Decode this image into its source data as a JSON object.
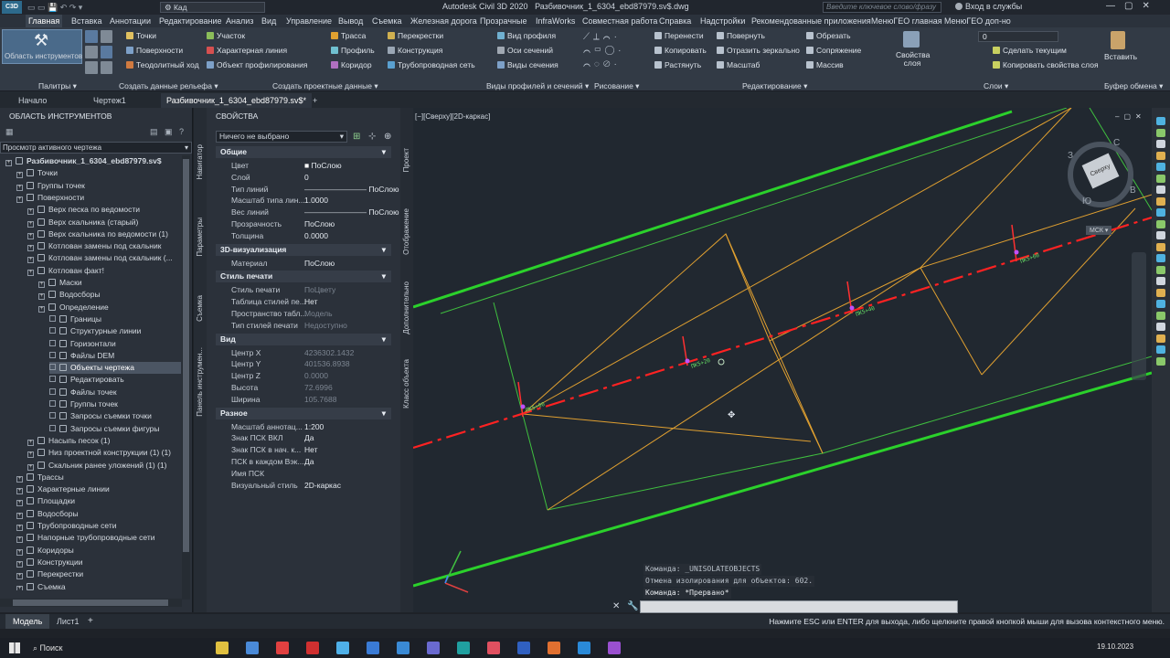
{
  "title": {
    "app": "Autodesk Civil 3D 2020",
    "file": "Разбивочник_1_6304_ebd87979.sv$.dwg",
    "quick_workspace": "Кад",
    "search_placeholder": "Введите ключевое слово/фразу",
    "signin": "Вход в службы"
  },
  "menu_tabs": [
    "Главная",
    "Вставка",
    "Аннотации",
    "Редактирование",
    "Анализ",
    "Вид",
    "Управление",
    "Вывод",
    "Съемка",
    "Железная дорога",
    "Прозрачные",
    "InfraWorks",
    "Совместная работа",
    "Справка",
    "Надстройки",
    "Рекомендованные приложения",
    "МенюГЕО главная",
    "МенюГЕО доп-но"
  ],
  "ribbon": {
    "toolspace_label": "Область инструментов",
    "palettes": "Палитры",
    "terrain_items": [
      "Точки",
      "Поверхности",
      "Теодолитный ход"
    ],
    "terrain_group": "Создать данные рельефа",
    "design_items": [
      "Участок",
      "Характерная линия",
      "Объект профилирования",
      "Трасса",
      "Профиль",
      "Коридор",
      "Перекрестки",
      "Конструкция",
      "Трубопроводная сеть"
    ],
    "design_group": "Создать проектные данные",
    "views_items": [
      "Вид профиля",
      "Оси сечений",
      "Виды сечения"
    ],
    "views_group": "Виды профилей и сечений",
    "draw_group": "Рисование",
    "edit_items": [
      "Перенести",
      "Копировать",
      "Растянуть",
      "Повернуть",
      "Отразить зеркально",
      "Масштаб",
      "Обрезать",
      "Сопряжение",
      "Массив"
    ],
    "edit_group": "Редактирование",
    "layer_props": "Свойства слоя",
    "layer_value": "0",
    "layer_items": [
      "Сделать текущим",
      "Копировать свойства слоя"
    ],
    "layers_group": "Слои",
    "paste": "Вставить",
    "clipboard_group": "Буфер обмена"
  },
  "doc_tabs": [
    "Начало",
    "Чертеж1",
    "Разбивочник_1_6304_ebd87979.sv$*"
  ],
  "toolspace": {
    "title": "ОБЛАСТЬ ИНСТРУМЕНТОВ",
    "view_select": "Просмотр активного чертежа",
    "tree": [
      {
        "label": "Разбивочник_1_6304_ebd87979.sv$",
        "indent": 0,
        "bold": true
      },
      {
        "label": "Точки",
        "indent": 1
      },
      {
        "label": "Группы точек",
        "indent": 1
      },
      {
        "label": "Поверхности",
        "indent": 1
      },
      {
        "label": "Верх песка по ведомости",
        "indent": 2
      },
      {
        "label": "Верх скальника (старый)",
        "indent": 2
      },
      {
        "label": "Верх скальника по ведомости (1)",
        "indent": 2
      },
      {
        "label": "Котлован замены под скальник",
        "indent": 2
      },
      {
        "label": "Котлован замены под скальник (...",
        "indent": 2
      },
      {
        "label": "Котлован факт!",
        "indent": 2
      },
      {
        "label": "Маски",
        "indent": 3
      },
      {
        "label": "Водосборы",
        "indent": 3
      },
      {
        "label": "Определение",
        "indent": 3
      },
      {
        "label": "Границы",
        "indent": 4
      },
      {
        "label": "Структурные линии",
        "indent": 4
      },
      {
        "label": "Горизонтали",
        "indent": 4
      },
      {
        "label": "Файлы DEM",
        "indent": 4
      },
      {
        "label": "Объекты чертежа",
        "indent": 4,
        "selected": true
      },
      {
        "label": "Редактировать",
        "indent": 4
      },
      {
        "label": "Файлы точек",
        "indent": 4
      },
      {
        "label": "Группы точек",
        "indent": 4
      },
      {
        "label": "Запросы съемки точки",
        "indent": 4
      },
      {
        "label": "Запросы съемки фигуры",
        "indent": 4
      },
      {
        "label": "Насыпь песок (1)",
        "indent": 2
      },
      {
        "label": "Низ проектной конструкции (1) (1)",
        "indent": 2
      },
      {
        "label": "Скальник ранее уложений (1) (1)",
        "indent": 2
      },
      {
        "label": "Трассы",
        "indent": 1
      },
      {
        "label": "Характерные линии",
        "indent": 1
      },
      {
        "label": "Площадки",
        "indent": 1
      },
      {
        "label": "Водосборы",
        "indent": 1
      },
      {
        "label": "Трубопроводные сети",
        "indent": 1
      },
      {
        "label": "Напорные трубопроводные сети",
        "indent": 1
      },
      {
        "label": "Коридоры",
        "indent": 1
      },
      {
        "label": "Конструкции",
        "indent": 1
      },
      {
        "label": "Перекрестки",
        "indent": 1
      },
      {
        "label": "Съемка",
        "indent": 1
      }
    ]
  },
  "side_tabs": [
    "Навигатор",
    "Параметры",
    "Съемка",
    "Панель инструмен..."
  ],
  "props_side_tabs": [
    "Проект",
    "Отображение",
    "Дополнительно",
    "Класс объекта"
  ],
  "properties": {
    "title": "СВОЙСТВА",
    "selection": "Ничего не выбрано",
    "sections": [
      {
        "name": "Общие",
        "rows": [
          [
            "Цвет",
            "ПоСлою",
            ""
          ],
          [
            "Слой",
            "0",
            ""
          ],
          [
            "Тип линий",
            "ПоСлою",
            "line"
          ],
          [
            "Масштаб типа лин...",
            "1.0000",
            ""
          ],
          [
            "Вес линий",
            "ПоСлою",
            "line"
          ],
          [
            "Прозрачность",
            "ПоСлою",
            ""
          ],
          [
            "Толщина",
            "0.0000",
            ""
          ]
        ]
      },
      {
        "name": "3D-визуализация",
        "rows": [
          [
            "Материал",
            "ПоСлою",
            ""
          ]
        ]
      },
      {
        "name": "Стиль печати",
        "rows": [
          [
            "Стиль печати",
            "ПоЦвету",
            "dim"
          ],
          [
            "Таблица стилей пе...",
            "Нет",
            ""
          ],
          [
            "Пространство табл...",
            "Модель",
            "dim"
          ],
          [
            "Тип стилей печати",
            "Недоступно",
            "dim"
          ]
        ]
      },
      {
        "name": "Вид",
        "rows": [
          [
            "Центр X",
            "4236302.1432",
            "dim"
          ],
          [
            "Центр Y",
            "401536.8938",
            "dim"
          ],
          [
            "Центр Z",
            "0.0000",
            "dim"
          ],
          [
            "Высота",
            "72.6996",
            "dim"
          ],
          [
            "Ширина",
            "105.7688",
            "dim"
          ]
        ]
      },
      {
        "name": "Разное",
        "rows": [
          [
            "Масштаб аннотац...",
            "1:200",
            ""
          ],
          [
            "Знак ПСК ВКЛ",
            "Да",
            ""
          ],
          [
            "Знак ПСК в нач. к...",
            "Нет",
            ""
          ],
          [
            "ПСК в каждом Вэк...",
            "Да",
            ""
          ],
          [
            "Имя ПСК",
            "",
            ""
          ],
          [
            "Визуальный стиль",
            "2D-каркас",
            ""
          ]
        ]
      }
    ]
  },
  "viewport": {
    "label": "[−][Сверху][2D-каркас]",
    "viewcube_top": "Сверху",
    "compass": {
      "n": "С",
      "s": "Ю",
      "w": "З",
      "e": "В"
    },
    "ucs": "МСК"
  },
  "command": {
    "lines": [
      "Команда:  _UNISOLATEOBJECTS",
      "Отмена изолирования для объектов: 602.",
      "Команда: *Прервано*"
    ]
  },
  "layout_tabs": [
    "Модель",
    "Лист1"
  ],
  "status_text": "Нажмите ESC или ENTER для выхода, либо щелкните правой кнопкой мыши для вызова контекстного меню.",
  "taskbar": {
    "search": "Поиск",
    "date": "19.10.2023"
  }
}
